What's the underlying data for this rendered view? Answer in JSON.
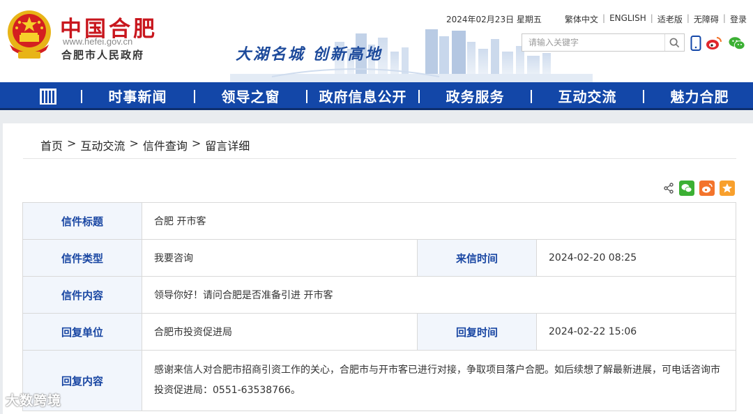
{
  "header": {
    "site_name": "中国合肥",
    "site_url": "www.hefei.gov.cn",
    "site_org": "合肥市人民政府",
    "slogan": "大湖名城  创新高地",
    "date": "2024年02月23日 星期五",
    "top_links": [
      "繁体中文",
      "ENGLISH",
      "适老版",
      "无障碍",
      "登录"
    ],
    "search_placeholder": "请输入关键字"
  },
  "nav": {
    "items": [
      "时事新闻",
      "领导之窗",
      "政府信息公开",
      "政务服务",
      "互动交流",
      "魅力合肥"
    ]
  },
  "breadcrumb": [
    "首页",
    "互动交流",
    "信件查询",
    "留言详细"
  ],
  "letter": {
    "title_label": "信件标题",
    "title_value": "合肥 开市客",
    "type_label": "信件类型",
    "type_value": "我要咨询",
    "time_label": "来信时间",
    "time_value": "2024-02-20 08:25",
    "content_label": "信件内容",
    "content_value": "领导你好！请问合肥是否准备引进 开市客",
    "reply_unit_label": "回复单位",
    "reply_unit_value": "合肥市投资促进局",
    "reply_time_label": "回复时间",
    "reply_time_value": "2024-02-22 15:06",
    "reply_content_label": "回复内容",
    "reply_content_value": "感谢来信人对合肥市招商引资工作的关心，合肥市与开市客已进行对接，争取项目落户合肥。如后续想了解最新进展，可电话咨询市投资促进局：0551-63538766。"
  },
  "watermark": "大数跨境",
  "colors": {
    "brand_red": "#c8161d",
    "nav_blue": "#1347a8",
    "label_blue": "#1a47a3",
    "wechat_green": "#3cb034",
    "weibo_orange": "#f3742c",
    "star_orange": "#f8a02d"
  }
}
